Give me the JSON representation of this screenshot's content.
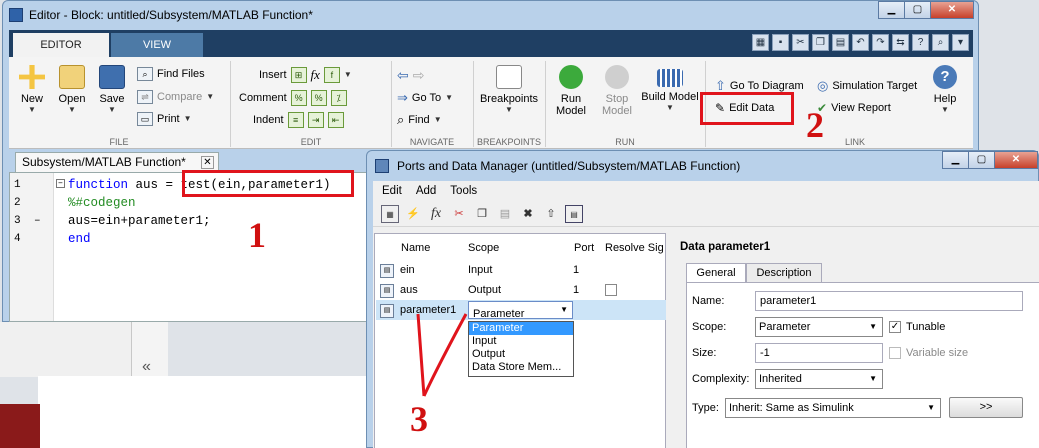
{
  "editor": {
    "title": "Editor - Block: untitled/Subsystem/MATLAB Function*",
    "tabs": [
      "EDITOR",
      "VIEW"
    ],
    "file": {
      "new": "New",
      "open": "Open",
      "save": "Save",
      "find_files": "Find Files",
      "compare": "Compare",
      "print": "Print",
      "section": "FILE"
    },
    "edit": {
      "insert": "Insert",
      "comment": "Comment",
      "indent": "Indent",
      "section": "EDIT"
    },
    "navigate": {
      "go_to": "Go To",
      "find": "Find",
      "section": "NAVIGATE"
    },
    "breakpoints": {
      "label": "Breakpoints",
      "section": "BREAKPOINTS"
    },
    "run": {
      "run": "Run",
      "model": "Model",
      "stop": "Stop",
      "build_model": "Build Model",
      "section": "RUN"
    },
    "simulink": {
      "go_to_diagram": "Go To Diagram",
      "simulation_target": "Simulation Target",
      "edit_data": "Edit Data",
      "view_report": "View Report",
      "help": "Help",
      "section_partial": "LINK"
    },
    "doc_tab": "Subsystem/MATLAB Function*",
    "code": {
      "line_numbers": [
        "1",
        "2",
        "3",
        "4"
      ],
      "line1_kw": "function",
      "line1_rest": " aus = test(ein,parameter1)",
      "line2": "%#codegen",
      "line3": "aus=ein+parameter1;",
      "line4": "end"
    }
  },
  "annotations": {
    "one": "1",
    "two": "2",
    "three": "3"
  },
  "pdm": {
    "title": "Ports and Data Manager (untitled/Subsystem/MATLAB Function)",
    "menu": [
      "Edit",
      "Add",
      "Tools"
    ],
    "columns": {
      "name": "Name",
      "scope": "Scope",
      "port": "Port",
      "resolve": "Resolve Sig"
    },
    "rows": [
      {
        "name": "ein",
        "scope": "Input",
        "port": "1"
      },
      {
        "name": "aus",
        "scope": "Output",
        "port": "1"
      },
      {
        "name": "parameter1",
        "scope": "Parameter",
        "port": ""
      }
    ],
    "dropdown_options": [
      "Parameter",
      "Input",
      "Output",
      "Data Store Mem..."
    ],
    "props": {
      "title": "Data parameter1",
      "tab_general": "General",
      "tab_description": "Description",
      "name_label": "Name:",
      "name_value": "parameter1",
      "scope_label": "Scope:",
      "scope_value": "Parameter",
      "tunable_label": "Tunable",
      "size_label": "Size:",
      "size_value": "-1",
      "variable_size_label": "Variable size",
      "complexity_label": "Complexity:",
      "complexity_value": "Inherited",
      "type_label": "Type:",
      "type_value": "Inherit: Same as Simulink",
      "more_button": ">>"
    }
  },
  "background": {
    "collapse_glyph": "«"
  }
}
